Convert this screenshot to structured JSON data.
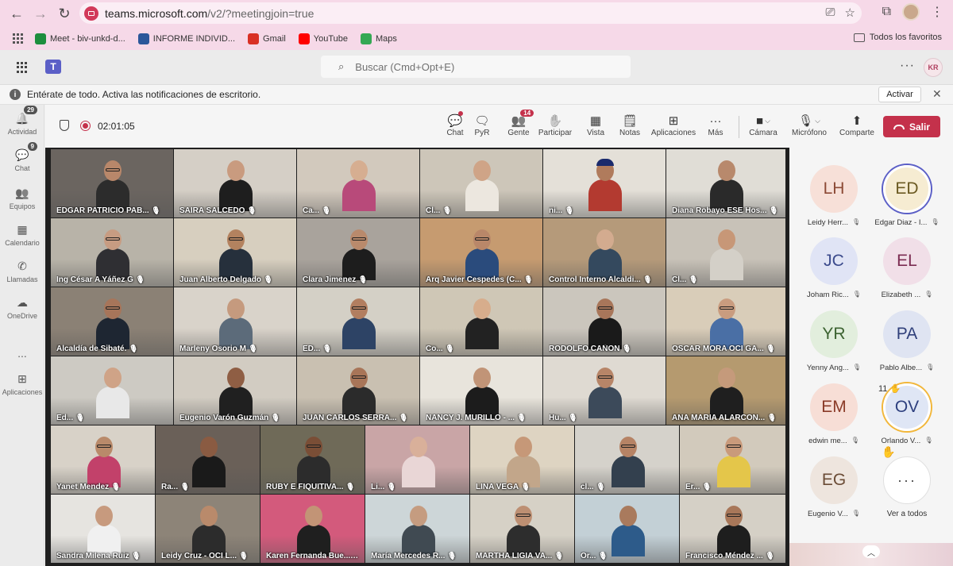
{
  "browser": {
    "url_host": "teams.microsoft.com",
    "url_path": "/v2/?meetingjoin=true",
    "bookmarks": [
      {
        "label": "Meet - biv-unkd-d...",
        "icon": "meet-icon",
        "color": "#1e8e3e"
      },
      {
        "label": "INFORME INDIVID...",
        "icon": "word-icon",
        "color": "#2b579a"
      },
      {
        "label": "Gmail",
        "icon": "gmail-icon",
        "color": "#d93025"
      },
      {
        "label": "YouTube",
        "icon": "youtube-icon",
        "color": "#ff0000"
      },
      {
        "label": "Maps",
        "icon": "maps-icon",
        "color": "#34a853"
      }
    ],
    "all_favorites": "Todos los favoritos"
  },
  "teams": {
    "search_placeholder": "Buscar (Cmd+Opt+E)",
    "user_initials": "KR",
    "notification": {
      "text": "Entérate de todo. Activa las notificaciones de escritorio.",
      "action": "Activar"
    },
    "rail": [
      {
        "label": "Actividad",
        "icon": "bell-icon",
        "badge": "29"
      },
      {
        "label": "Chat",
        "icon": "chat-icon",
        "badge": "9"
      },
      {
        "label": "Equipos",
        "icon": "teams-icon",
        "badge": ""
      },
      {
        "label": "Calendario",
        "icon": "calendar-icon",
        "badge": ""
      },
      {
        "label": "Llamadas",
        "icon": "phone-icon",
        "badge": ""
      },
      {
        "label": "OneDrive",
        "icon": "cloud-icon",
        "badge": ""
      },
      {
        "label": "...",
        "icon": "more-icon",
        "badge": ""
      },
      {
        "label": "Aplicaciones",
        "icon": "plus-icon",
        "badge": ""
      }
    ]
  },
  "meeting": {
    "timer": "02:01:05",
    "toolbar": [
      {
        "label": "Chat",
        "icon": "chat-icon",
        "glyph": "💬",
        "badge": "",
        "dot": true
      },
      {
        "label": "PyR",
        "icon": "qa-icon",
        "glyph": "🗨",
        "badge": "",
        "dot": false
      },
      {
        "label": "Gente",
        "icon": "people-icon",
        "glyph": "👥",
        "badge": "14",
        "dot": false
      },
      {
        "label": "Participar",
        "icon": "raise-hand-icon",
        "glyph": "✋",
        "badge": "",
        "dot": false
      },
      {
        "label": "Vista",
        "icon": "grid-icon",
        "glyph": "▦",
        "badge": "",
        "dot": false
      },
      {
        "label": "Notas",
        "icon": "notes-icon",
        "glyph": "🗒",
        "badge": "",
        "dot": false
      },
      {
        "label": "Aplicaciones",
        "icon": "apps-icon",
        "glyph": "⊞",
        "badge": "",
        "dot": false
      },
      {
        "label": "Más",
        "icon": "more-icon",
        "glyph": "···",
        "badge": "",
        "dot": false
      },
      {
        "label": "Cámara",
        "icon": "camera-icon",
        "glyph": "■",
        "badge": "",
        "dot": false
      },
      {
        "label": "Micrófono",
        "icon": "mic-icon",
        "glyph": "🎙",
        "badge": "",
        "dot": false
      },
      {
        "label": "Comparte",
        "icon": "share-icon",
        "glyph": "⬆",
        "badge": "",
        "dot": false
      }
    ],
    "leave_label": "Salir",
    "tiles": [
      {
        "name": "EDGAR PATRICIO PAB...",
        "bg": "#6b6560",
        "skin": "#b8876a",
        "shirt": "#2c2c2c",
        "glasses": true,
        "cap": false
      },
      {
        "name": "SAIRA SALCEDO",
        "bg": "#d5cfc6",
        "skin": "#c99b7f",
        "shirt": "#1e1e1e",
        "glasses": false,
        "cap": false
      },
      {
        "name": "Ca...",
        "bg": "#d2c9bd",
        "skin": "#d6ae91",
        "shirt": "#b84a7a",
        "glasses": false,
        "cap": false
      },
      {
        "name": "Cl...",
        "bg": "#cdc6b9",
        "skin": "#cfa487",
        "shirt": "#ece7df",
        "glasses": false,
        "cap": false
      },
      {
        "name": "ni...",
        "bg": "#e4e0d8",
        "skin": "#b07b5c",
        "shirt": "#b33a30",
        "glasses": false,
        "cap": true
      },
      {
        "name": "Diana Robayo ESE Hos...",
        "bg": "#e0ddd6",
        "skin": "#b8896c",
        "shirt": "#2a2a2a",
        "glasses": false,
        "cap": false
      },
      {
        "name": "Ing César A Yáñez G",
        "bg": "#b8b3a8",
        "skin": "#c79c82",
        "shirt": "#2f2f33",
        "glasses": true,
        "cap": false
      },
      {
        "name": "Juan Alberto Delgado",
        "bg": "#d7cfbf",
        "skin": "#b3825f",
        "shirt": "#26303c",
        "glasses": true,
        "cap": false
      },
      {
        "name": "Clara Jimenez",
        "bg": "#a9a39c",
        "skin": "#b98a6c",
        "shirt": "#1d1d1d",
        "glasses": true,
        "cap": false
      },
      {
        "name": "Arq Javier Cespedes (C...",
        "bg": "#c69b70",
        "skin": "#b98769",
        "shirt": "#2a4b7c",
        "glasses": true,
        "cap": false
      },
      {
        "name": "Control Interno Alcaldi...",
        "bg": "#b59a7a",
        "skin": "#d3ab8f",
        "shirt": "#34495e",
        "glasses": false,
        "cap": false
      },
      {
        "name": "Cl...",
        "bg": "#c8c2b8",
        "skin": "#c79777",
        "shirt": "#d4d0c8",
        "glasses": false,
        "cap": false
      },
      {
        "name": "Alcaldía de Sibaté.",
        "bg": "#8b8175",
        "skin": "#a7755a",
        "shirt": "#1e2632",
        "glasses": true,
        "cap": false
      },
      {
        "name": "Marleny Osorio M",
        "bg": "#d9d3ca",
        "skin": "#c59a7e",
        "shirt": "#5c6b7a",
        "glasses": false,
        "cap": false
      },
      {
        "name": "ED...",
        "bg": "#d4d0c6",
        "skin": "#b27e60",
        "shirt": "#2d4365",
        "glasses": true,
        "cap": false
      },
      {
        "name": "Co...",
        "bg": "#cfc7b6",
        "skin": "#d7ad8c",
        "shirt": "#222222",
        "glasses": false,
        "cap": false
      },
      {
        "name": "RODOLFO CAÑON",
        "bg": "#cbc6bd",
        "skin": "#a8765a",
        "shirt": "#1a1a1a",
        "glasses": true,
        "cap": false
      },
      {
        "name": "OSCAR MORA OCI GA...",
        "bg": "#d9cdb9",
        "skin": "#c99c7f",
        "shirt": "#4a6fa5",
        "glasses": true,
        "cap": false
      },
      {
        "name": "Ed...",
        "bg": "#cdcac3",
        "skin": "#cfa387",
        "shirt": "#e8e8e8",
        "glasses": false,
        "cap": false
      },
      {
        "name": "Eugenio Varón Guzmán",
        "bg": "#d2ccc2",
        "skin": "#8f5e44",
        "shirt": "#202020",
        "glasses": false,
        "cap": false
      },
      {
        "name": "JUAN CARLOS SERRA...",
        "bg": "#c9c0b1",
        "skin": "#a87558",
        "shirt": "#2b2b2b",
        "glasses": true,
        "cap": false
      },
      {
        "name": "NANCY J. MURILLO - ...",
        "bg": "#e8e4dc",
        "skin": "#c19477",
        "shirt": "#1c1c1c",
        "glasses": false,
        "cap": false
      },
      {
        "name": "Hu...",
        "bg": "#dfdad2",
        "skin": "#b78568",
        "shirt": "#3c4a5a",
        "glasses": true,
        "cap": false
      },
      {
        "name": "ANA MARIA ALARCON...",
        "bg": "#b59a6f",
        "skin": "#c59a7b",
        "shirt": "#1f1f1f",
        "glasses": false,
        "cap": false
      },
      {
        "name": "Yanet Mendez",
        "bg": "#d8d2c8",
        "skin": "#b98a6a",
        "shirt": "#c2416a",
        "glasses": true,
        "cap": false
      },
      {
        "name": "Ra...",
        "bg": "#6a6058",
        "skin": "#8a5b42",
        "shirt": "#1a1a1a",
        "glasses": false,
        "cap": false
      },
      {
        "name": "RUBY E FIQUITIVA...",
        "bg": "#6f6a58",
        "skin": "#7a4e36",
        "shirt": "#2c2c2c",
        "glasses": true,
        "cap": false
      },
      {
        "name": "Li...",
        "bg": "#c9a5a6",
        "skin": "#d9b09a",
        "shirt": "#e9d6d6",
        "glasses": false,
        "cap": false
      },
      {
        "name": "LINA  VEGA",
        "bg": "#ded4c2",
        "skin": "#c69878",
        "shirt": "#c2a68a",
        "glasses": false,
        "cap": false
      },
      {
        "name": "cl...",
        "bg": "#d5d2cb",
        "skin": "#b68365",
        "shirt": "#33404e",
        "glasses": true,
        "cap": false
      },
      {
        "name": "Er...",
        "bg": "#d2cabc",
        "skin": "#c99a7b",
        "shirt": "#e4c64a",
        "glasses": true,
        "cap": false
      },
      {
        "name": "Sandra Milena Ruiz",
        "bg": "#e6e4e0",
        "skin": "#c79a7e",
        "shirt": "#f0f0f0",
        "glasses": false,
        "cap": false
      },
      {
        "name": "Leidy Cruz - OCI L...",
        "bg": "#8d8478",
        "skin": "#b98a6b",
        "shirt": "#2c2c2c",
        "glasses": false,
        "cap": false
      },
      {
        "name": "Karen Fernanda Bue...",
        "bg": "#d35a7c",
        "skin": "#c29476",
        "shirt": "#1f1f1f",
        "glasses": false,
        "cap": false
      },
      {
        "name": "María Mercedes R...",
        "bg": "#cdd6d8",
        "skin": "#c59c80",
        "shirt": "#404a52",
        "glasses": false,
        "cap": false
      },
      {
        "name": "MARTHA LIGIA VA...",
        "bg": "#d6d1c6",
        "skin": "#bd8f72",
        "shirt": "#2d2d2d",
        "glasses": true,
        "cap": false
      },
      {
        "name": "Or...",
        "bg": "#c3d0d6",
        "skin": "#a97a5d",
        "shirt": "#2d5b8a",
        "glasses": false,
        "cap": false
      },
      {
        "name": "Francisco Méndez ...",
        "bg": "#d5d0c6",
        "skin": "#a87759",
        "shirt": "#1e1e1e",
        "glasses": true,
        "cap": false
      }
    ],
    "participants": [
      {
        "initials": "LH",
        "name": "Leidy Herr...",
        "bg": "#f7e0d8",
        "color": "#8c4a36",
        "ring": false,
        "hand": ""
      },
      {
        "initials": "ED",
        "name": "Edgar Diaz - I...",
        "bg": "#f6ecd2",
        "color": "#6b5a22",
        "ring": true,
        "hand": ""
      },
      {
        "initials": "JC",
        "name": "Joham Ric...",
        "bg": "#e0e4f5",
        "color": "#3b4a8c",
        "ring": false,
        "hand": ""
      },
      {
        "initials": "EL",
        "name": "Elizabeth ...",
        "bg": "#f1dfe8",
        "color": "#7b2c52",
        "ring": false,
        "hand": ""
      },
      {
        "initials": "YR",
        "name": "Yenny Ang...",
        "bg": "#e2eedd",
        "color": "#3c6231",
        "ring": false,
        "hand": ""
      },
      {
        "initials": "PA",
        "name": "Pablo Albe...",
        "bg": "#dfe4f2",
        "color": "#2f3f7a",
        "ring": false,
        "hand": ""
      },
      {
        "initials": "EM",
        "name": "edwin me...",
        "bg": "#f7ded6",
        "color": "#8a3b28",
        "ring": false,
        "hand": ""
      },
      {
        "initials": "OV",
        "name": "Orlando V...",
        "bg": "#dfe6f5",
        "color": "#2d3f7e",
        "ring": true,
        "hand": "11"
      },
      {
        "initials": "EG",
        "name": "Eugenio V...",
        "bg": "#eee5de",
        "color": "#6b4c36",
        "ring": false,
        "hand": ""
      }
    ],
    "see_all": "Ver a todos"
  }
}
